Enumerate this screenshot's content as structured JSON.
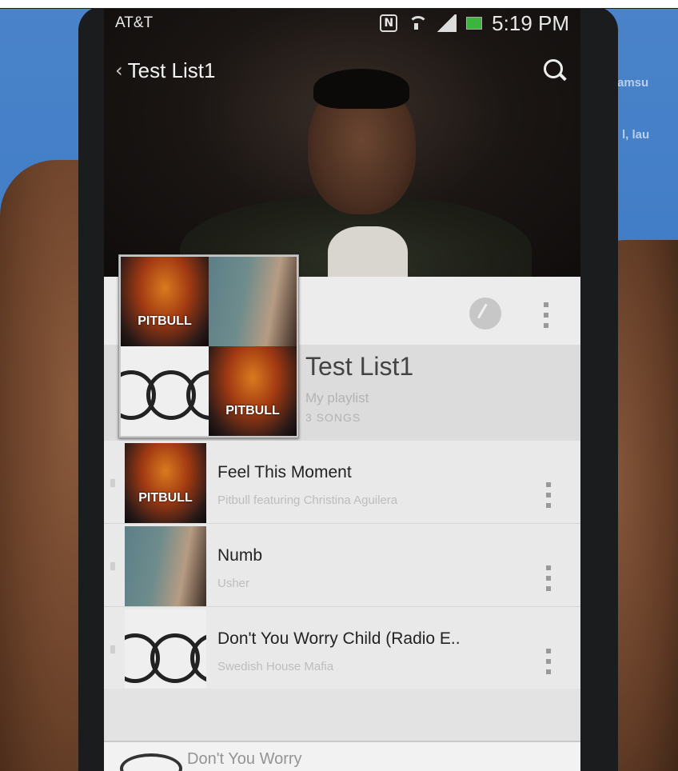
{
  "status_bar": {
    "carrier": "AT&T",
    "nfc": "N",
    "time": "5:19 PM",
    "battery_color": "#3cb53c"
  },
  "action_bar": {
    "title": "Test List1",
    "back_icon": "chevron-left-icon",
    "search_icon": "search-icon"
  },
  "playlist": {
    "title": "Test List1",
    "subtitle": "My playlist",
    "song_count": "3 SONGS",
    "mosaic": [
      {
        "art": "PITBULL"
      },
      {
        "art": ""
      },
      {
        "art": ""
      },
      {
        "art": "PITBULL"
      }
    ]
  },
  "songs": [
    {
      "title": "Feel This Moment",
      "artist": "Pitbull featuring Christina Aguilera",
      "art": "PITBULL"
    },
    {
      "title": "Numb",
      "artist": "Usher",
      "art": ""
    },
    {
      "title": "Don't You Worry Child (Radio E..",
      "artist": "Swedish House Mafia",
      "art": ""
    }
  ],
  "mini_player": {
    "title": "Don't You Worry"
  },
  "colors": {
    "wall": "#3f7cc6",
    "list_bg": "#e9e9e9"
  }
}
